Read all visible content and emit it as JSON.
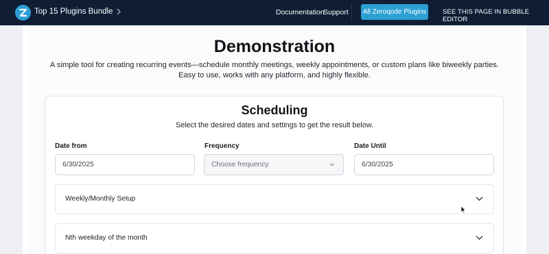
{
  "navbar": {
    "logo_icon": "zeroqode-logo-icon",
    "bundle_label": "Top 15 Plugins Bundle",
    "bundle_icon": "chevron-right-icon",
    "links": {
      "documentation": "Documentation",
      "support": "Support"
    },
    "all_plugins_button": "All Zeroqode Plugins",
    "editor_link": "SEE THIS PAGE IN BUBBLE EDITOR",
    "colors": {
      "background": "#0f1e35",
      "accent": "#2a9fd2"
    }
  },
  "header": {
    "title": "Demonstration",
    "subtitle_line1": "A simple tool for creating recurring events—schedule monthly meetings, weekly appointments, or custom plans like biweekly parties.",
    "subtitle_line2": "Easy to use, works with any platform, and highly flexible."
  },
  "scheduling": {
    "title": "Scheduling",
    "subtitle": "Select the desired dates and settings to get the result below.",
    "date_from": {
      "label": "Date from",
      "value": "6/30/2025"
    },
    "frequency": {
      "label": "Frequency",
      "placeholder": "Choose frequency",
      "icon": "chevron-down-icon"
    },
    "date_until": {
      "label": "Date Until",
      "value": "6/30/2025"
    },
    "sections": [
      {
        "label": "Weekly/Monthly Setup",
        "icon": "chevron-down-icon"
      },
      {
        "label": "Nth weekday of the month",
        "icon": "chevron-down-icon"
      }
    ]
  },
  "cursor_icon": "mouse-pointer-icon"
}
